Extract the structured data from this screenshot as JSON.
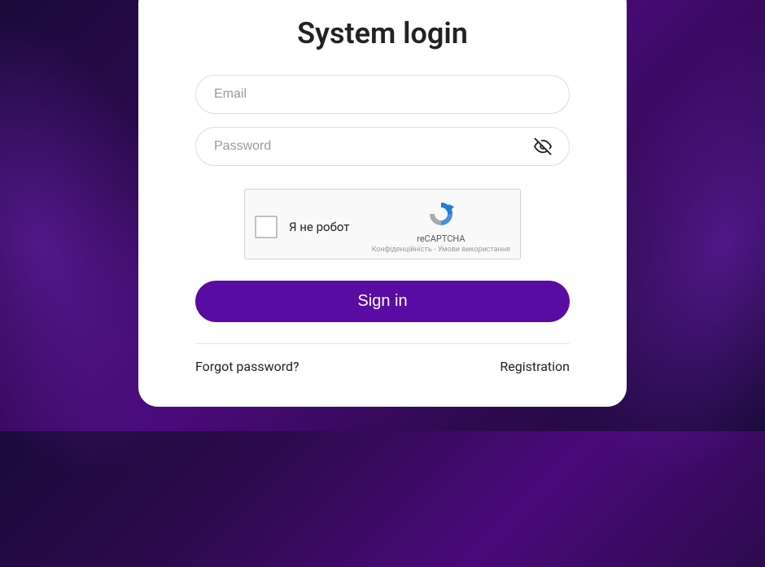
{
  "lang": "",
  "title": "System login",
  "email": {
    "placeholder": "Email",
    "value": ""
  },
  "password": {
    "placeholder": "Password",
    "value": ""
  },
  "captcha": {
    "label": "Я не робот",
    "brand": "reCAPTCHA",
    "terms": "Конфіденційність - Умови використання"
  },
  "signin_label": "Sign in",
  "forgot_label": "Forgot password?",
  "registration_label": "Registration"
}
